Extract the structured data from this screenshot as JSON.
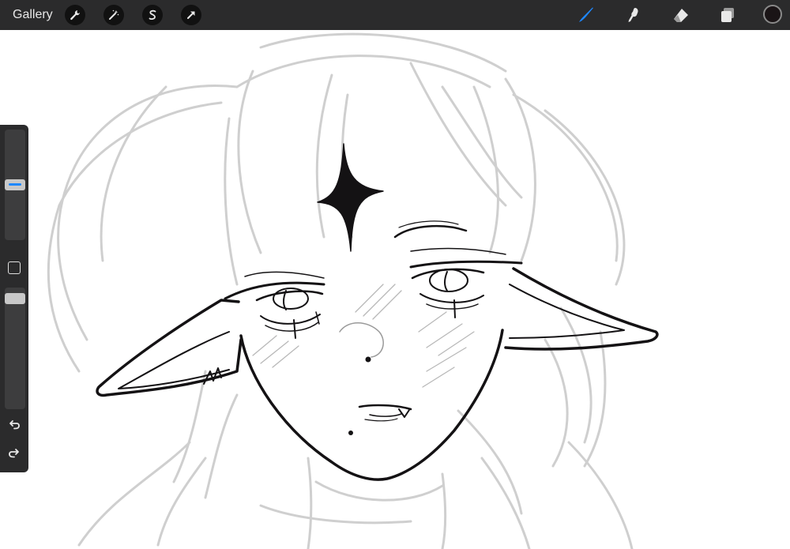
{
  "app": {
    "gallery_label": "Gallery"
  },
  "toolbar": {
    "left_tools": [
      {
        "icon": "wrench-icon",
        "name": "actions"
      },
      {
        "icon": "magic-wand-icon",
        "name": "adjustments"
      },
      {
        "icon": "selection-s-icon",
        "name": "selection"
      },
      {
        "icon": "arrow-cursor-icon",
        "name": "transform"
      }
    ],
    "right_tools": [
      {
        "icon": "brush-icon",
        "name": "brush",
        "active": true
      },
      {
        "icon": "smudge-icon",
        "name": "smudge",
        "active": false
      },
      {
        "icon": "eraser-icon",
        "name": "eraser",
        "active": false
      },
      {
        "icon": "layers-icon",
        "name": "layers",
        "active": false
      }
    ],
    "current_color": "#1a1416"
  },
  "sidebar": {
    "brush_size_level": 0.5,
    "opacity_level": 0.95
  },
  "colors": {
    "bar_bg": "#2b2b2c",
    "accent": "#1e88ff",
    "icon_fg": "#e8e8e8",
    "ink": "#141214",
    "sketch": "#c9c9c9"
  }
}
